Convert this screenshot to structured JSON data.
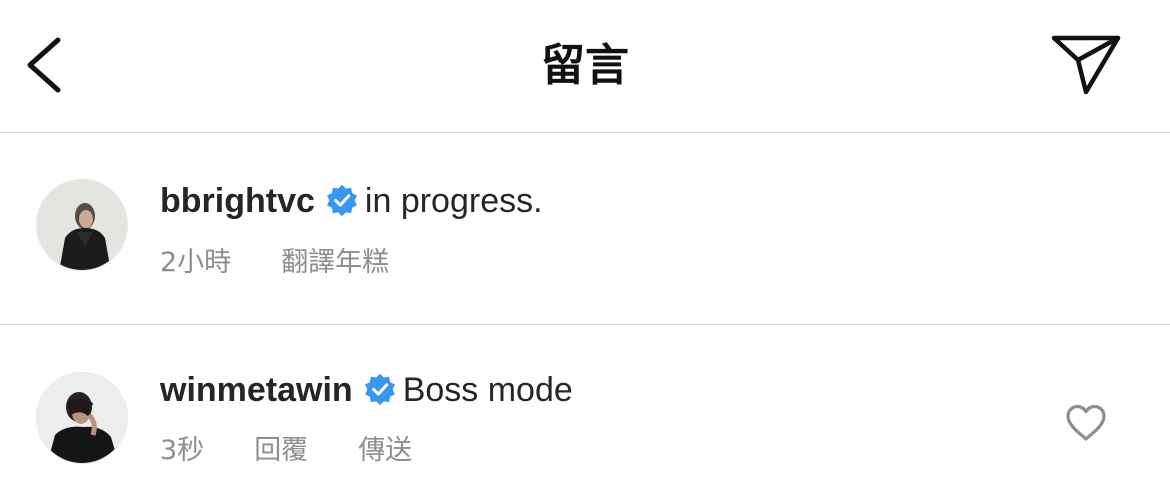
{
  "header": {
    "title": "留言"
  },
  "comments": [
    {
      "username": "bbrightvc",
      "verified": true,
      "text": "in progress.",
      "time": "2小時",
      "actions": [
        "翻譯年糕"
      ]
    },
    {
      "username": "winmetawin",
      "verified": true,
      "text": "Boss mode",
      "time": "3秒",
      "actions": [
        "回覆",
        "傳送"
      ]
    }
  ],
  "colors": {
    "verified_badge": "#3897f0",
    "meta_text": "#8e8e8e",
    "divider": "#dbdbdb"
  },
  "icons": {
    "back": "chevron-left-icon",
    "share": "paper-plane-icon",
    "like": "heart-outline-icon",
    "verified": "verified-badge-icon"
  }
}
